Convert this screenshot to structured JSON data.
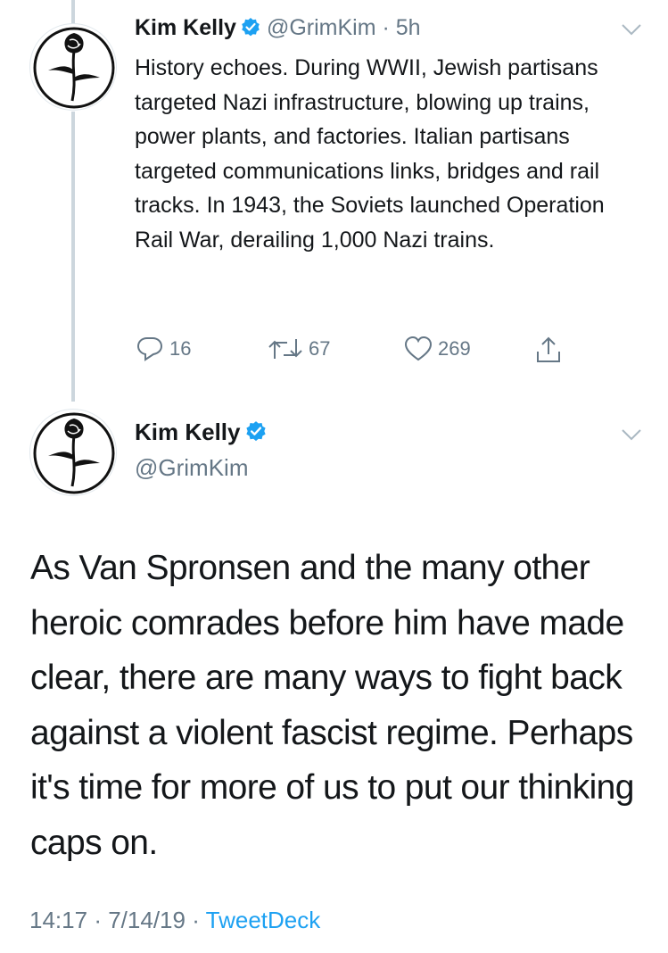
{
  "tweet1": {
    "name": "Kim Kelly",
    "handle": "@GrimKim",
    "separator": "·",
    "time": "5h",
    "text": "History echoes. During WWII, Jewish partisans targeted Nazi infrastructure, blowing up trains, power plants, and factories. Italian partisans targeted communications links, bridges and rail tracks. In 1943, the Soviets launched Operation Rail War, derailing 1,000 Nazi trains.",
    "replies": "16",
    "retweets": "67",
    "likes": "269"
  },
  "tweet2": {
    "name": "Kim Kelly",
    "handle": "@GrimKim",
    "text": "As Van Spronsen and the many other heroic comrades before him have made clear, there are many ways to fight back against a violent fascist regime. Perhaps it's time for more of us to put our thinking caps on.",
    "time": "14:17",
    "date": "7/14/19",
    "separator": "·",
    "source": "TweetDeck"
  },
  "colors": {
    "text": "#14171a",
    "secondary": "#657786",
    "link": "#1da1f2",
    "verified": "#1da1f2",
    "thread": "#ccd6dd"
  },
  "icons": {
    "avatar": "black-rose-icon",
    "verified": "verified-badge-icon",
    "menu": "chevron-down-icon",
    "reply": "reply-icon",
    "retweet": "retweet-icon",
    "like": "heart-icon",
    "share": "share-icon"
  }
}
